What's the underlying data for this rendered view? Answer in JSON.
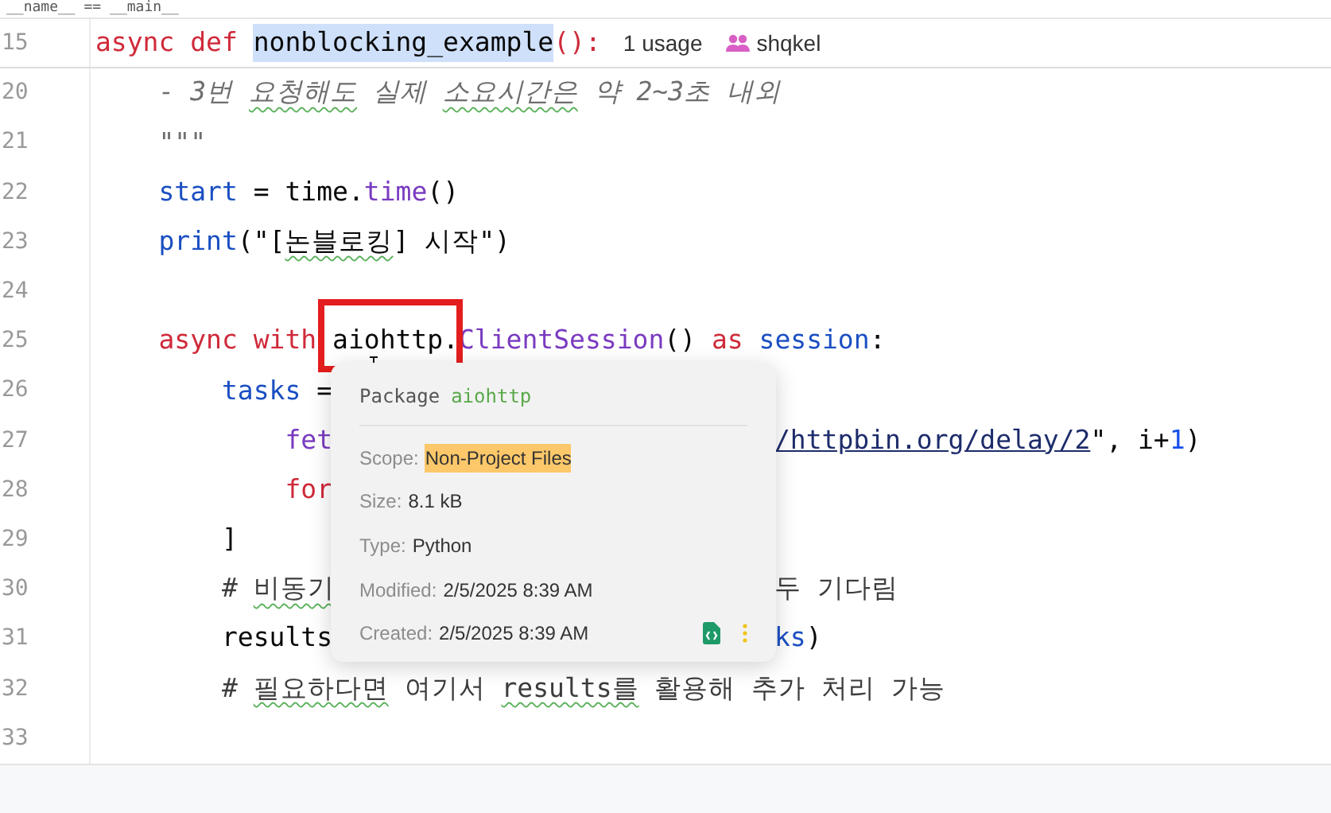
{
  "sticky_breadcrumb": "__name__ == __main__",
  "header_line": {
    "number": "15",
    "tokens": [
      {
        "text": "async def ",
        "kind": "keyword",
        "typo": false
      },
      {
        "text": "nonblocking_example",
        "kind": "selected_name",
        "typo": false
      },
      {
        "text": "():",
        "kind": "keyword",
        "typo": false
      }
    ],
    "inlay_hints": [
      {
        "kind": "usages",
        "text": "1 usage"
      },
      {
        "kind": "author",
        "text": "shqkel"
      }
    ]
  },
  "lines": [
    {
      "number": "20",
      "tokens": [
        {
          "text": "    - 3번 ",
          "kind": "docstring",
          "typo": false
        },
        {
          "text": "요청해도",
          "kind": "docstring",
          "typo": true
        },
        {
          "text": " 실제 ",
          "kind": "docstring",
          "typo": false
        },
        {
          "text": "소요시간은",
          "kind": "docstring",
          "typo": true
        },
        {
          "text": " 약 2~3초 내외",
          "kind": "docstring",
          "typo": false
        }
      ]
    },
    {
      "number": "21",
      "tokens": [
        {
          "text": "    \"\"\"",
          "kind": "docstring",
          "typo": false
        }
      ]
    },
    {
      "number": "22",
      "tokens": [
        {
          "text": "    start",
          "kind": "variable",
          "typo": false
        },
        {
          "text": " = ",
          "kind": "plain",
          "typo": false
        },
        {
          "text": "time.",
          "kind": "plain",
          "typo": false
        },
        {
          "text": "time",
          "kind": "method",
          "typo": false
        },
        {
          "text": "()",
          "kind": "plain",
          "typo": false
        }
      ]
    },
    {
      "number": "23",
      "tokens": [
        {
          "text": "    print",
          "kind": "variable",
          "typo": false
        },
        {
          "text": "(\"[",
          "kind": "plain",
          "typo": false
        },
        {
          "text": "논블로킹",
          "kind": "plain",
          "typo": true
        },
        {
          "text": "] 시작\")",
          "kind": "plain",
          "typo": false
        }
      ]
    },
    {
      "number": "24"
    },
    {
      "number": "25",
      "tokens": [
        {
          "text": "    async with ",
          "kind": "keyword",
          "typo": false
        },
        {
          "text": "aiohttp.",
          "kind": "plain",
          "typo": false
        },
        {
          "text": "ClientSession",
          "kind": "method",
          "typo": false
        },
        {
          "text": "() ",
          "kind": "plain",
          "typo": false
        },
        {
          "text": "as",
          "kind": "keyword",
          "typo": false
        },
        {
          "text": " session",
          "kind": "variable",
          "typo": false
        },
        {
          "text": ":",
          "kind": "plain",
          "typo": false
        }
      ]
    },
    {
      "number": "26",
      "tokens": [
        {
          "text": "        tasks",
          "kind": "variable",
          "typo": false
        },
        {
          "text": " =",
          "kind": "plain",
          "typo": false
        }
      ]
    },
    {
      "number": "27",
      "tokens": [
        {
          "text": "            fet",
          "kind": "method",
          "typo": false
        }
      ],
      "right_tokens": [
        {
          "text": "/httpbin.org/delay/2",
          "kind": "url",
          "typo": false
        },
        {
          "text": "\", i+",
          "kind": "plain",
          "typo": false
        },
        {
          "text": "1",
          "kind": "number",
          "typo": false
        },
        {
          "text": ")",
          "kind": "plain",
          "typo": false
        }
      ]
    },
    {
      "number": "28",
      "tokens": [
        {
          "text": "            for",
          "kind": "keyword",
          "typo": false
        }
      ]
    },
    {
      "number": "29",
      "tokens": [
        {
          "text": "        ]",
          "kind": "plain",
          "typo": false
        }
      ]
    },
    {
      "number": "30",
      "tokens": [
        {
          "text": "        # ",
          "kind": "comment",
          "typo": false
        },
        {
          "text": "비동기",
          "kind": "comment",
          "typo": true
        }
      ],
      "right_tokens": [
        {
          "text": "두 기다림",
          "kind": "comment",
          "typo": false
        }
      ]
    },
    {
      "number": "31",
      "tokens": [
        {
          "text": "        results",
          "kind": "plain",
          "typo": false
        }
      ],
      "right_tokens": [
        {
          "text": "ks",
          "kind": "variable",
          "typo": false
        },
        {
          "text": ")",
          "kind": "plain",
          "typo": false
        }
      ]
    },
    {
      "number": "32",
      "tokens": [
        {
          "text": "        # ",
          "kind": "comment",
          "typo": false
        },
        {
          "text": "필요하다면",
          "kind": "comment",
          "typo": true
        },
        {
          "text": " 여기서 ",
          "kind": "comment",
          "typo": false
        },
        {
          "text": "results를",
          "kind": "comment",
          "typo": true
        },
        {
          "text": " 활용해 추가 처리 가능",
          "kind": "comment",
          "typo": false
        }
      ]
    },
    {
      "number": "33"
    }
  ],
  "popup": {
    "title_label": "Package",
    "title_value": "aiohttp",
    "rows": [
      {
        "label": "Scope:",
        "value": "Non-Project Files",
        "highlighted": true
      },
      {
        "label": "Size:",
        "value": "8.1 kB",
        "highlighted": false
      },
      {
        "label": "Type:",
        "value": "Python",
        "highlighted": false
      },
      {
        "label": "Modified:",
        "value": "2/5/2025 8:39 AM",
        "highlighted": false
      },
      {
        "label": "Created:",
        "value": "2/5/2025 8:39 AM",
        "highlighted": false
      }
    ]
  }
}
